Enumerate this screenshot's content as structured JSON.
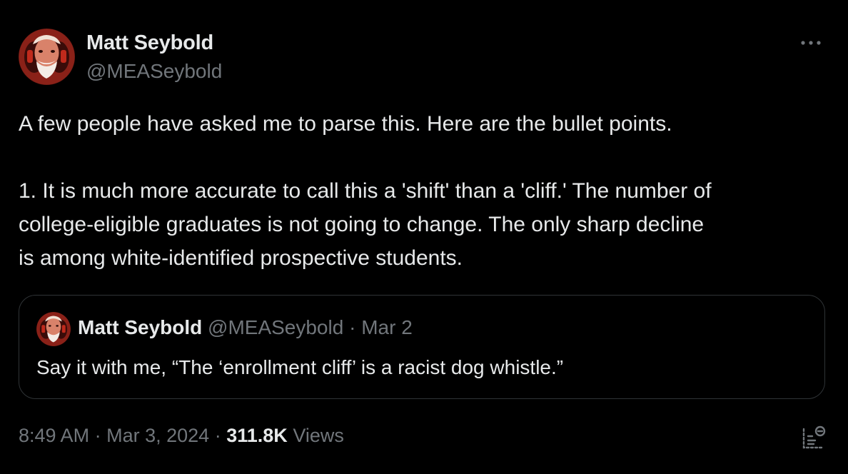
{
  "author": {
    "name": "Matt Seybold",
    "handle": "@MEASeybold",
    "avatar_icon": "avatar-portrait-red-tint"
  },
  "more_icon": "more-horizontal-icon",
  "tweet": {
    "lines": [
      "A few people have asked me to parse this. Here are the bullet points.",
      "",
      "1. It is much more accurate to call this a 'shift' than a 'cliff.' The number of",
      "college-eligible graduates is not going to change. The only sharp decline",
      "is among white-identified prospective students."
    ]
  },
  "quote": {
    "name": "Matt Seybold",
    "handle": "@MEASeybold",
    "separator": "·",
    "date": "Mar 2",
    "text": "Say it with me, “The ‘enrollment cliff’ is a racist dog whistle.”"
  },
  "footer": {
    "time": "8:49 AM",
    "separator1": "·",
    "date": "Mar 3, 2024",
    "separator2": "·",
    "views_count": "311.8K",
    "views_label": "Views",
    "analytics_icon": "analytics-icon"
  },
  "colors": {
    "background": "#000000",
    "text_primary": "#e7e9ea",
    "text_secondary": "#71767b",
    "border": "#2f3336"
  }
}
